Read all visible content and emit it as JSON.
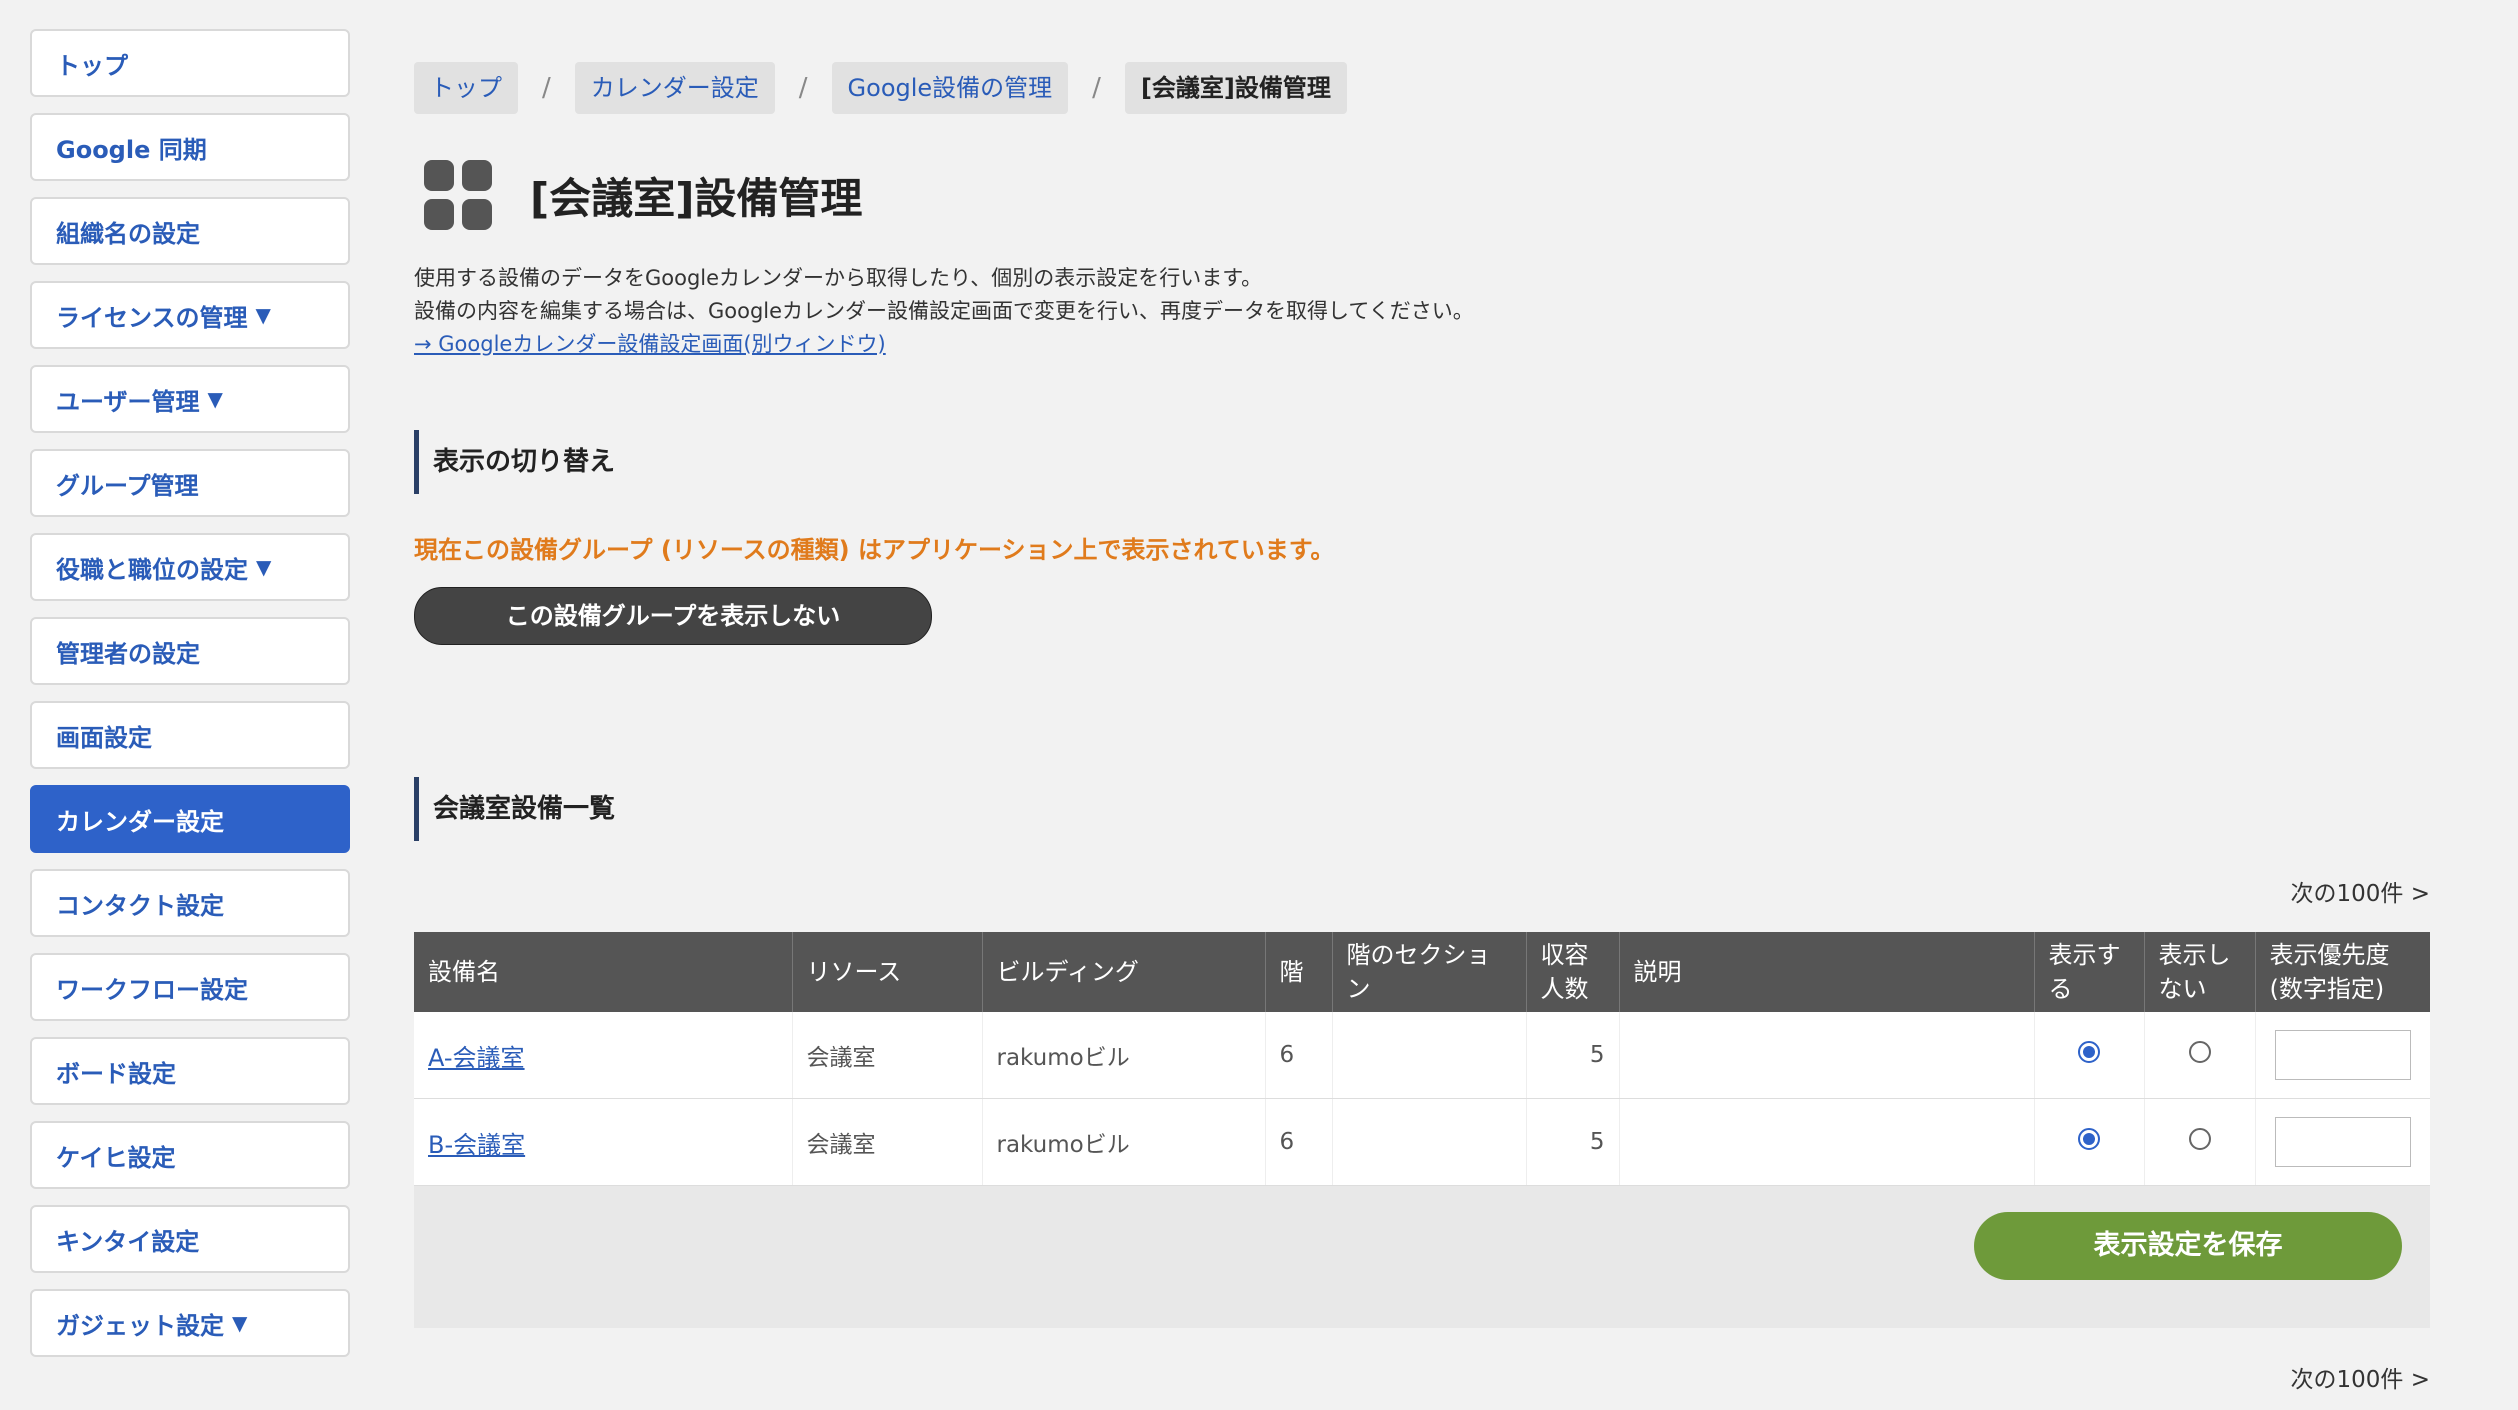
{
  "sidebar": {
    "items": [
      {
        "label": "トップ",
        "arrow": ""
      },
      {
        "label": "Google 同期",
        "arrow": ""
      },
      {
        "label": "組織名の設定",
        "arrow": ""
      },
      {
        "label": "ライセンスの管理",
        "arrow": "▼"
      },
      {
        "label": "ユーザー管理",
        "arrow": "▼"
      },
      {
        "label": "グループ管理",
        "arrow": ""
      },
      {
        "label": "役職と職位の設定",
        "arrow": "▼"
      },
      {
        "label": "管理者の設定",
        "arrow": ""
      },
      {
        "label": "画面設定",
        "arrow": ""
      },
      {
        "label": "カレンダー設定",
        "arrow": ""
      },
      {
        "label": "コンタクト設定",
        "arrow": ""
      },
      {
        "label": "ワークフロー設定",
        "arrow": ""
      },
      {
        "label": "ボード設定",
        "arrow": ""
      },
      {
        "label": "ケイヒ設定",
        "arrow": ""
      },
      {
        "label": "キンタイ設定",
        "arrow": ""
      },
      {
        "label": "ガジェット設定",
        "arrow": "▼"
      }
    ],
    "active_item": "カレンダー設定",
    "accent_color": "#2e62c9"
  },
  "breadcrumb": {
    "items": [
      "トップ",
      "カレンダー設定",
      "Google設備の管理",
      "[会議室]設備管理"
    ],
    "separator": "/"
  },
  "page": {
    "title": "[会議室]設備管理",
    "title_icon": "apps-grid-icon",
    "desc_line1": "使用する設備のデータをGoogleカレンダーから取得したり、個別の表示設定を行います。",
    "desc_line2": "設備の内容を編集する場合は、Googleカレンダー設備設定画面で変更を行い、再度データを取得してください。",
    "desc_link": "→ Googleカレンダー設備設定画面(別ウィンドウ)"
  },
  "display_toggle": {
    "heading": "表示の切り替え",
    "status": "現在この設備グループ (リソースの種類) はアプリケーション上で表示されています。",
    "status_color": "#e07b1c",
    "button": "この設備グループを表示しない"
  },
  "facility_list": {
    "heading": "会議室設備一覧",
    "next_link": "次の100件 >",
    "columns": {
      "name": "設備名",
      "resource": "リソース",
      "building": "ビルディング",
      "floor": "階",
      "section": "階のセクション",
      "capacity": "収容人数",
      "description": "説明",
      "show": "表示する",
      "hide": "表示しない",
      "priority": "表示優先度(数字指定)"
    },
    "rows": [
      {
        "name": "A-会議室",
        "resource": "会議室",
        "building": "rakumoビル",
        "floor": "6",
        "section": "",
        "capacity": "5",
        "description": "",
        "show": true,
        "priority": ""
      },
      {
        "name": "B-会議室",
        "resource": "会議室",
        "building": "rakumoビル",
        "floor": "6",
        "section": "",
        "capacity": "5",
        "description": "",
        "show": true,
        "priority": ""
      }
    ],
    "save_button": "表示設定を保存",
    "save_color": "#6e9a3a"
  }
}
